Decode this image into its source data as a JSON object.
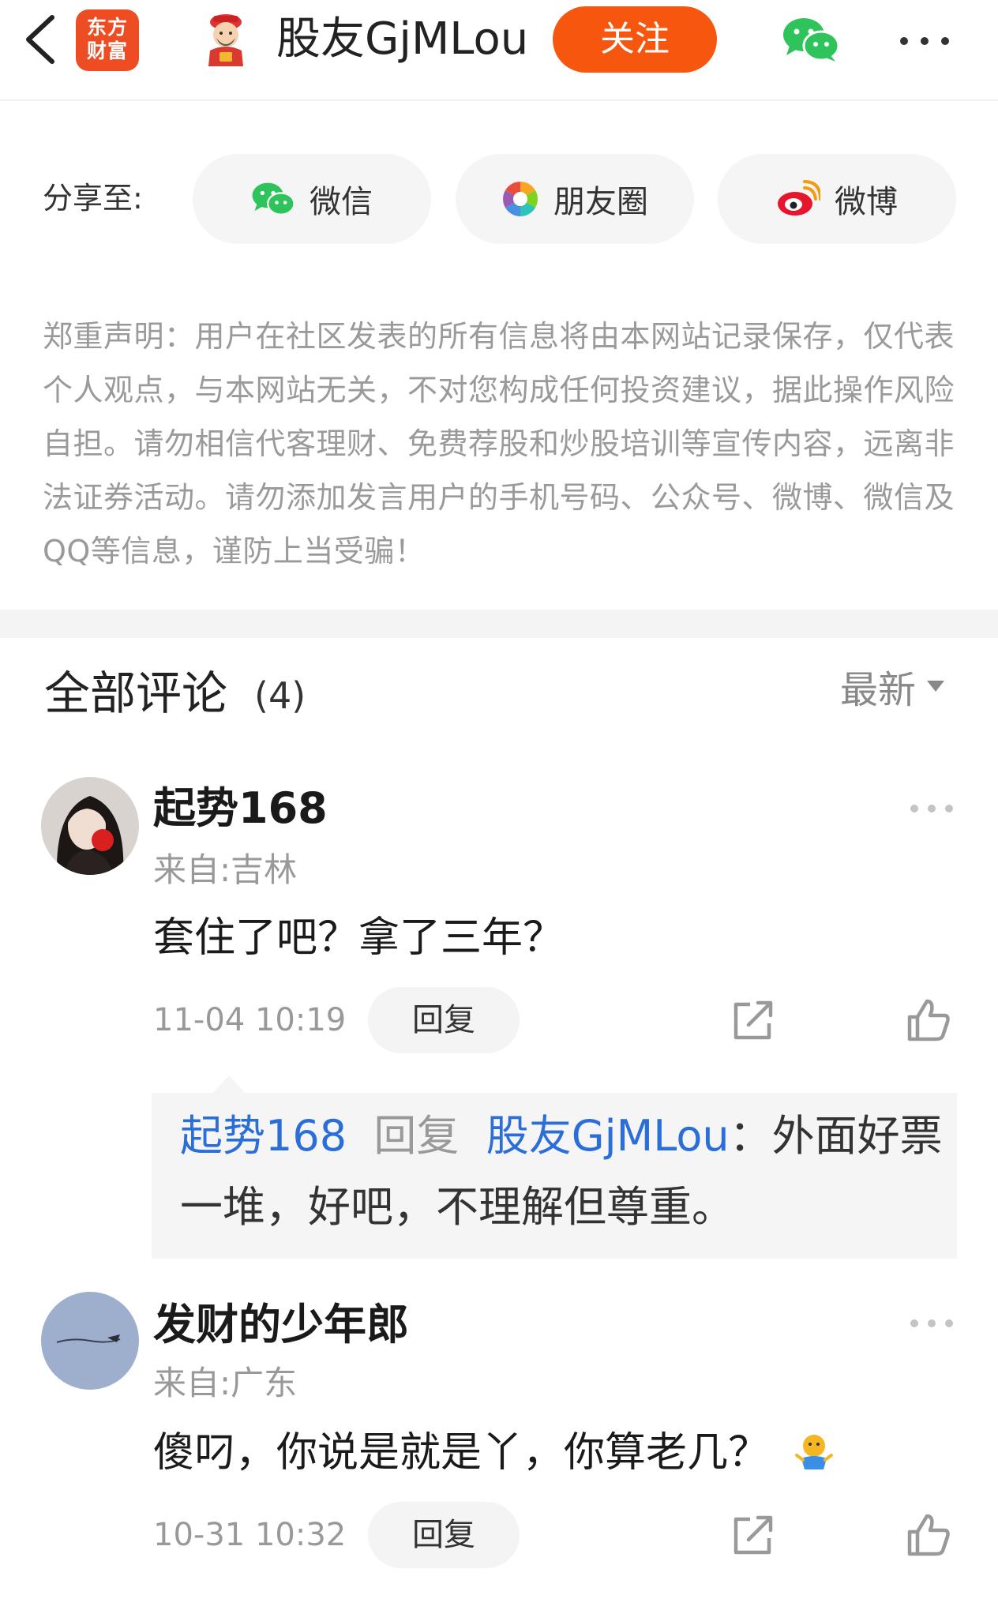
{
  "header": {
    "app_logo_line1": "东方",
    "app_logo_line2": "财富",
    "author_name": "股友GjMLou",
    "follow_label": "关注"
  },
  "share": {
    "label": "分享至:",
    "options": [
      "微信",
      "朋友圈",
      "微博"
    ]
  },
  "disclaimer": "郑重声明：用户在社区发表的所有信息将由本网站记录保存，仅代表个人观点，与本网站无关，不对您构成任何投资建议，据此操作风险自担。请勿相信代客理财、免费荐股和炒股培训等宣传内容，远离非法证券活动。请勿添加发言用户的手机号码、公众号、微博、微信及QQ等信息，谨防上当受骗！",
  "comments_header": {
    "title": "全部评论",
    "count": "(4)",
    "sort_label": "最新"
  },
  "comments": [
    {
      "username": "起势168",
      "location": "来自:吉林",
      "text": "套住了吧？拿了三年？",
      "time": "11-04 10:19",
      "reply_label": "回复",
      "replies": [
        {
          "from": "起势168",
          "action": "回复",
          "to": "股友GjMLou",
          "separator": "：",
          "text_line1": "外面好票",
          "text_line2": "一堆，好吧，不理解但尊重。"
        }
      ]
    },
    {
      "username": "发财的少年郎",
      "location": "来自:广东",
      "text": "傻叼，你说是就是丫，你算老几？",
      "time": "10-31 10:32",
      "reply_label": "回复"
    }
  ],
  "colors": {
    "brand_orange": "#ee4c22",
    "follow_orange": "#f7560f",
    "link_blue": "#2b6ed8",
    "wechat_green": "#2ec35b"
  },
  "icons": [
    "back-icon",
    "mascot-icon",
    "wechat-icon",
    "more-icon",
    "moments-icon",
    "weibo-icon",
    "share-icon",
    "like-icon",
    "emoji-icon"
  ]
}
